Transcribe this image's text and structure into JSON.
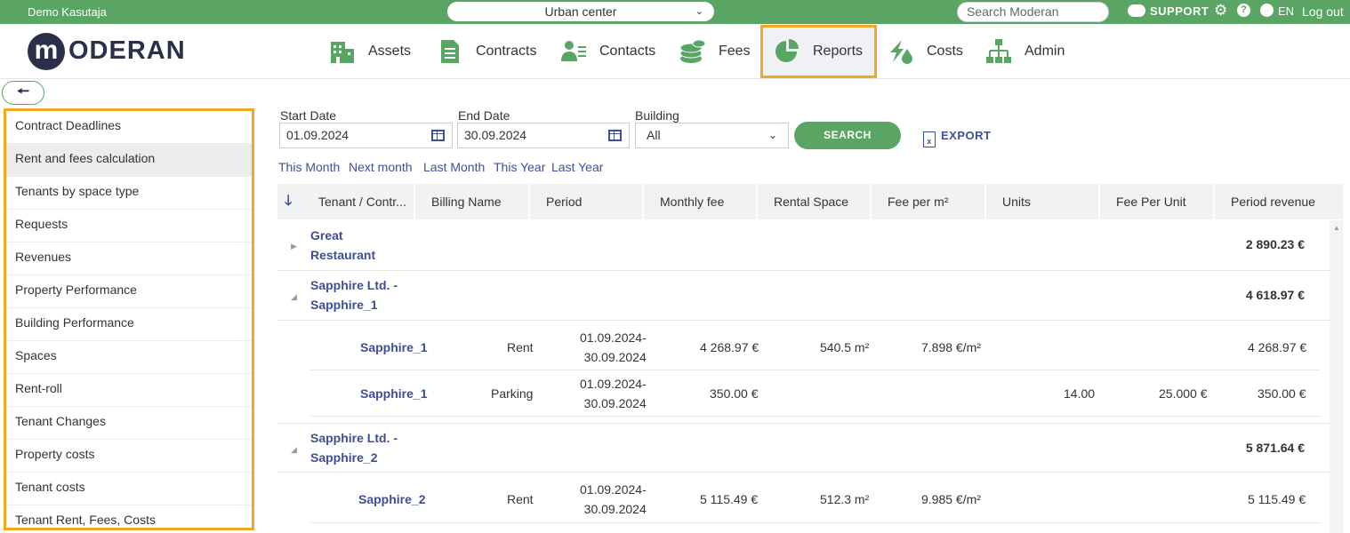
{
  "topbar": {
    "user": "Demo Kasutaja",
    "building_selected": "Urban center",
    "search_placeholder": "Search Moderan",
    "support": "SUPPORT",
    "lang": "EN",
    "logout": "Log out"
  },
  "logo": {
    "m": "m",
    "rest": "ODERAN"
  },
  "nav": [
    {
      "label": "Assets",
      "icon": "building-icon"
    },
    {
      "label": "Contracts",
      "icon": "document-icon"
    },
    {
      "label": "Contacts",
      "icon": "contacts-icon"
    },
    {
      "label": "Fees",
      "icon": "coins-icon"
    },
    {
      "label": "Reports",
      "icon": "pie-chart-icon",
      "active": true
    },
    {
      "label": "Costs",
      "icon": "utilities-icon"
    },
    {
      "label": "Admin",
      "icon": "org-chart-icon"
    }
  ],
  "sidebar": {
    "items": [
      "Contract Deadlines",
      "Rent and fees calculation",
      "Tenants by space type",
      "Requests",
      "Revenues",
      "Property Performance",
      "Building Performance",
      "Spaces",
      "Rent-roll",
      "Tenant Changes",
      "Property costs",
      "Tenant costs",
      "Tenant Rent, Fees, Costs"
    ],
    "active_index": 1
  },
  "filters": {
    "start_label": "Start Date",
    "start_value": "01.09.2024",
    "end_label": "End Date",
    "end_value": "30.09.2024",
    "building_label": "Building",
    "building_value": "All",
    "search_button": "SEARCH",
    "export_button": "EXPORT",
    "quick": [
      "This Month",
      "Next month",
      "Last Month",
      "This Year",
      "Last Year"
    ]
  },
  "table": {
    "columns": [
      "Tenant / Contr...",
      "Billing Name",
      "Period",
      "Monthly fee",
      "Rental Space",
      "Fee per m²",
      "Units",
      "Fee Per Unit",
      "Period revenue"
    ],
    "groups": [
      {
        "name_line1": "Great",
        "name_line2": "Restaurant",
        "total": "2 890.23 €",
        "expanded": false
      },
      {
        "name_line1": "Sapphire Ltd. -",
        "name_line2": "Sapphire_1",
        "total": "4 618.97 €",
        "expanded": true
      },
      {
        "name_line1": "Sapphire Ltd. -",
        "name_line2": "Sapphire_2",
        "total": "5 871.64 €",
        "expanded": true
      }
    ],
    "rows": [
      {
        "tenant": "Sapphire_1",
        "billing": "Rent",
        "period_from": "01.09.2024-",
        "period_to": "30.09.2024",
        "monthly": "4 268.97 €",
        "space": "540.5 m²",
        "fee_m2": "7.898 €/m²",
        "units": "",
        "fee_unit": "",
        "revenue": "4 268.97 €"
      },
      {
        "tenant": "Sapphire_1",
        "billing": "Parking",
        "period_from": "01.09.2024-",
        "period_to": "30.09.2024",
        "monthly": "350.00 €",
        "space": "",
        "fee_m2": "",
        "units": "14.00",
        "fee_unit": "25.000 €",
        "revenue": "350.00 €"
      },
      {
        "tenant": "Sapphire_2",
        "billing": "Rent",
        "period_from": "01.09.2024-",
        "period_to": "30.09.2024",
        "monthly": "5 115.49 €",
        "space": "512.3 m²",
        "fee_m2": "9.985 €/m²",
        "units": "",
        "fee_unit": "",
        "revenue": "5 115.49 €"
      }
    ]
  },
  "colors": {
    "green": "#5aa564",
    "navy": "#2c2f4a",
    "link": "#3d4f9a",
    "highlight": "#f5a623"
  }
}
